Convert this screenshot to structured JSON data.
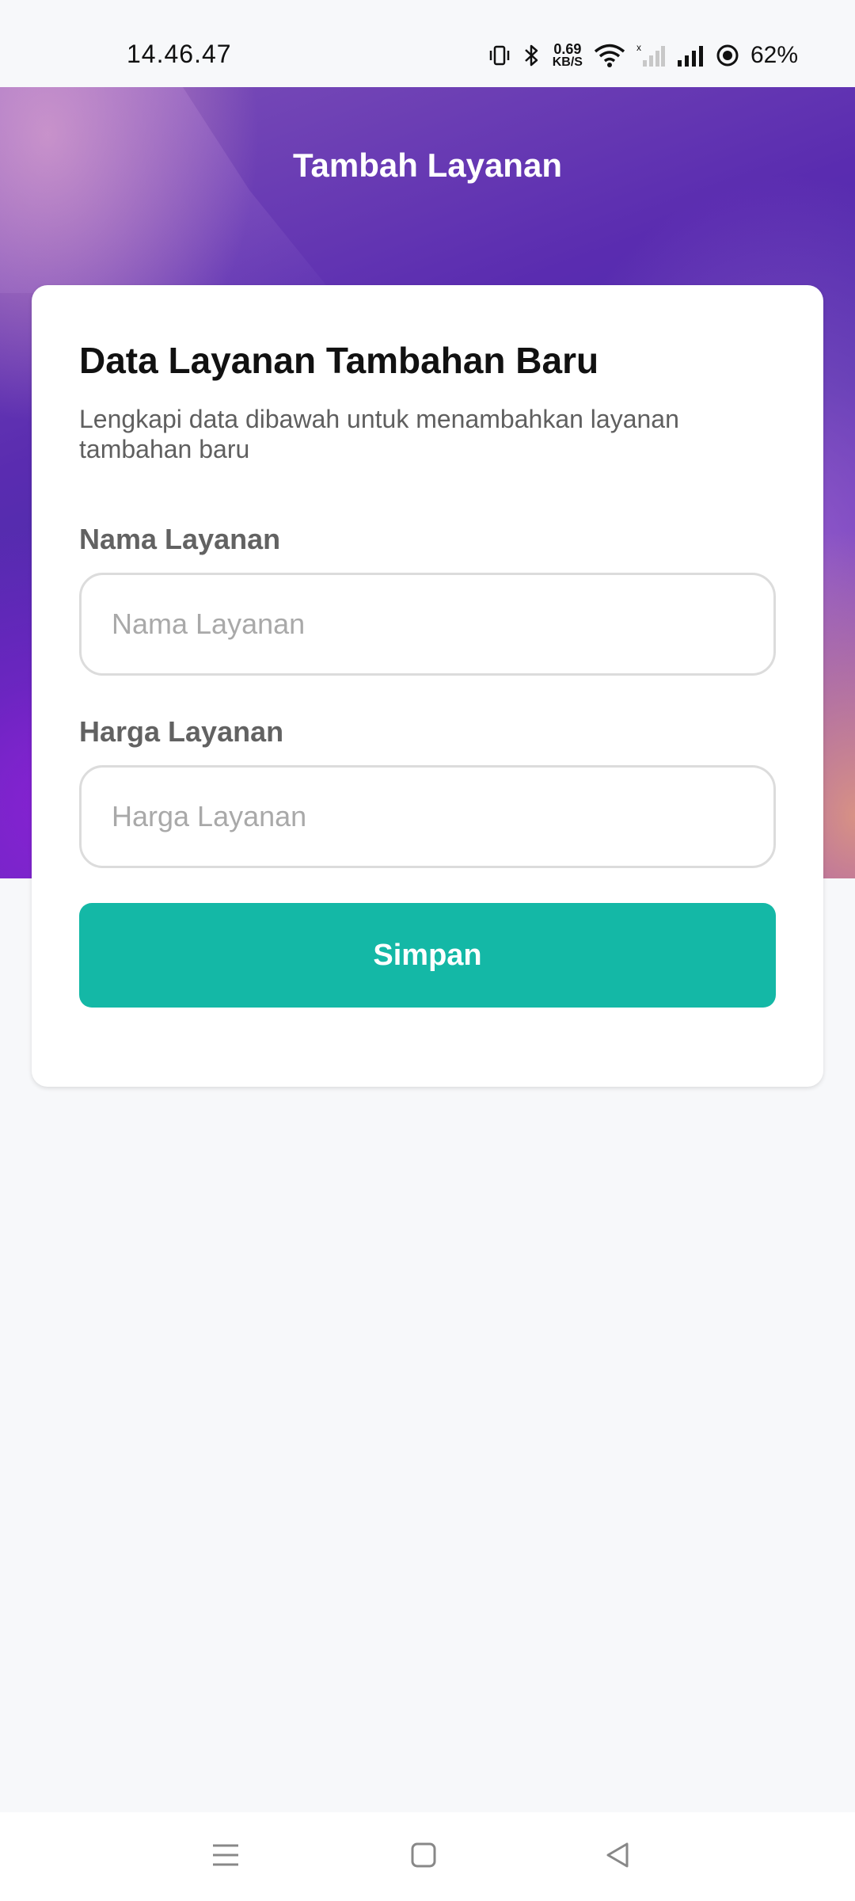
{
  "status_bar": {
    "time": "14.46.47",
    "net_speed_value": "0.69",
    "net_speed_unit": "KB/S",
    "battery": "62%",
    "icons": [
      "vibrate-icon",
      "bluetooth-icon",
      "wifi-icon",
      "signal-sim2-icon",
      "signal-sim1-icon",
      "battery-saver-icon"
    ]
  },
  "header": {
    "title": "Tambah Layanan"
  },
  "form": {
    "title": "Data Layanan Tambahan Baru",
    "subtitle": "Lengkapi data dibawah untuk menambahkan layanan tambahan baru",
    "fields": [
      {
        "label": "Nama Layanan",
        "placeholder": "Nama Layanan",
        "value": ""
      },
      {
        "label": "Harga Layanan",
        "placeholder": "Harga Layanan",
        "value": ""
      }
    ],
    "submit_label": "Simpan"
  },
  "nav_bar": {
    "buttons": [
      "menu-icon",
      "home-icon",
      "back-icon"
    ]
  },
  "colors": {
    "accent": "#14b8a6",
    "header_gradient_main": "#4a2bab",
    "background": "#f7f8fa"
  }
}
